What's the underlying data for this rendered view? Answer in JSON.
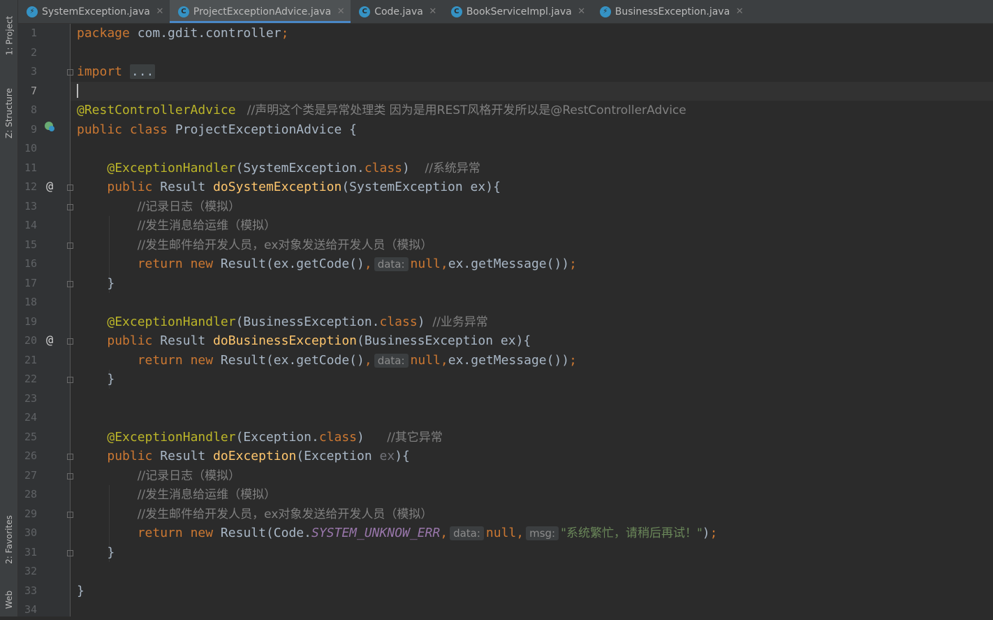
{
  "tool_strip": {
    "project_label": "1: Project",
    "structure_label": "Z: Structure",
    "favorites_label": "2: Favorites",
    "web_label": "Web"
  },
  "tabs": [
    {
      "label": "SystemException.java",
      "icon": "exception-class-icon",
      "active": false,
      "closable": true
    },
    {
      "label": "ProjectExceptionAdvice.java",
      "icon": "class-icon",
      "active": true,
      "closable": true
    },
    {
      "label": "Code.java",
      "icon": "class-icon",
      "active": false,
      "closable": true
    },
    {
      "label": "BookServiceImpl.java",
      "icon": "class-icon",
      "active": false,
      "closable": true
    },
    {
      "label": "BusinessException.java",
      "icon": "exception-class-icon",
      "active": false,
      "closable": true
    }
  ],
  "editor": {
    "current_line": "7",
    "line_numbers": [
      "1",
      "2",
      "3",
      "7",
      "8",
      "9",
      "10",
      "11",
      "12",
      "13",
      "14",
      "15",
      "16",
      "17",
      "18",
      "19",
      "20",
      "21",
      "22",
      "23",
      "24",
      "25",
      "26",
      "27",
      "28",
      "29",
      "30",
      "31",
      "32",
      "33",
      "34"
    ],
    "code": {
      "l1": {
        "kw": "package",
        "rest": " com.gdit.controller",
        "semi": ";"
      },
      "l3": {
        "kw": "import",
        "folded": "..."
      },
      "l8": {
        "ann": "@RestControllerAdvice",
        "comment": "   //声明这个类是异常处理类 因为是用REST风格开发所以是@RestControllerAdvice"
      },
      "l9": {
        "kw1": "public",
        "kw2": "class",
        "name": " ProjectExceptionAdvice {"
      },
      "l11": {
        "ann": "@ExceptionHandler",
        "args": "(SystemException.",
        "kw": "class",
        "close": ")",
        "comment": "    //系统异常"
      },
      "l12": {
        "kw": "public",
        "type": " Result ",
        "fn": "doSystemException",
        "params": "(SystemException ex){"
      },
      "l13": {
        "comment": "//记录日志（模拟）"
      },
      "l14": {
        "comment": "//发生消息给运维（模拟）"
      },
      "l15": {
        "comment": "//发生邮件给开发人员，ex对象发送给开发人员（模拟）"
      },
      "l16": {
        "kw1": "return",
        "kw2": "new",
        "call": " Result(ex.getCode()",
        "comma": ",",
        "hint": "data:",
        "null": "null",
        "rest": "ex.getMessage())",
        "semi": ";"
      },
      "l17": {
        "brace": "}"
      },
      "l19": {
        "ann": "@ExceptionHandler",
        "args": "(BusinessException.",
        "kw": "class",
        "close": ")",
        "comment": "  //业务异常"
      },
      "l20": {
        "kw": "public",
        "type": " Result ",
        "fn": "doBusinessException",
        "params": "(BusinessException ex){"
      },
      "l21": {
        "kw1": "return",
        "kw2": "new",
        "call": " Result(ex.getCode()",
        "comma": ",",
        "hint": "data:",
        "null": "null",
        "rest": "ex.getMessage())",
        "semi": ";"
      },
      "l22": {
        "brace": "}"
      },
      "l25": {
        "ann": "@ExceptionHandler",
        "args": "(Exception.",
        "kw": "class",
        "close": ")",
        "comment": "      //其它异常"
      },
      "l26": {
        "kw": "public",
        "type": " Result ",
        "fn": "doException",
        "params_a": "(Exception ",
        "unused": "ex",
        "params_b": "){"
      },
      "l27": {
        "comment": "//记录日志（模拟）"
      },
      "l28": {
        "comment": "//发生消息给运维（模拟）"
      },
      "l29": {
        "comment": "//发生邮件给开发人员，ex对象发送给开发人员（模拟）"
      },
      "l30": {
        "kw1": "return",
        "kw2": "new",
        "call": " Result(Code.",
        "const": "SYSTEM_UNKNOW_ERR",
        "comma": ",",
        "hint1": "data:",
        "null": "null",
        "comma2": ",",
        "hint2": "msg:",
        "str": "\"系统繁忙，请稍后再试！\"",
        "close": ")",
        "semi": ";"
      },
      "l31": {
        "brace": "}"
      },
      "l33": {
        "brace": "}"
      }
    }
  }
}
